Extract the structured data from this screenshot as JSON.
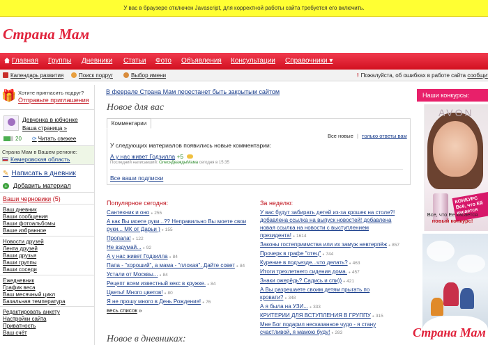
{
  "notice": "У вас в браузере отключен Javascript, для корректной работы сайта требуется его включить.",
  "logo": "Страна Мам",
  "nav": {
    "items": [
      "Главная",
      "Группы",
      "Дневники",
      "Статьи",
      "Фото",
      "Объявления",
      "Консультации",
      "Справочники ▾"
    ]
  },
  "toolbar": {
    "calendar": "Календарь развития",
    "friend_search": "Поиск подруг",
    "name_choice": "Выбор имени",
    "report_prefix": "Пожалуйста, об ошибках в работе сайта",
    "report_link": "сообщите"
  },
  "sidebar": {
    "invite_question": "Хотите пригласить подруг?",
    "invite_link": "Отправьте приглашения",
    "user_name": "Девчонка в юбчонке",
    "user_page": "Ваша страница »",
    "rating": "20",
    "read_fresh": "Читать свежее",
    "region_label": "Страна Мам в Вашем регионе:",
    "region_value": "Кемеровская область",
    "write_diary": "Написать в дневник",
    "add_material": "Добавить материал",
    "drafts": "Ваши черновики",
    "drafts_count": "(5)",
    "links1": [
      "Ваш дневник",
      "Ваши сообщения",
      "Ваши фотоальбомы",
      "Ваше избранное"
    ],
    "links2": [
      "Новости друзей",
      "Лента друзей",
      "Ваши друзья",
      "Ваши группы",
      "Ваши соседи"
    ],
    "links3": [
      "Ежедневник",
      "График веса",
      "Ваш месячный цикл",
      "Базальная температура"
    ],
    "links4": [
      "Редактировать анкету",
      "Настройки сайта",
      "Приватность",
      "Ваш счёт"
    ]
  },
  "center": {
    "announcement": "В феврале Страна Мам перестанет быть закрытым сайтом",
    "new_for_you": "Новое для вас",
    "tab": "Комментарии",
    "filter_all": "Все новые",
    "filter_yours": "только ответы вам",
    "comments_intro": "У следующих материалов появились новые комментарии:",
    "comment_title": "А у нас живет Годзилла",
    "comment_plus": "+5",
    "comment_meta_prefix": "Последний написавший:",
    "comment_author": "ОлесяДваждыМама",
    "comment_time": "сегодня в 15:35",
    "all_subs": "Все ваши подписки",
    "popular_today_title": "Популярное сегодня:",
    "popular_today": [
      {
        "text": "Сантехник и оно",
        "count": "255"
      },
      {
        "text": "А как Вы моете руки...?? Неправильно Вы моете свои",
        "count": ""
      },
      {
        "text": "руки... МК от Дарьи )",
        "count": "155"
      },
      {
        "text": "Пропала!",
        "count": "122"
      },
      {
        "text": "Не вздумай...",
        "count": "92"
      },
      {
        "text": "А у нас живет Годзилла",
        "count": "84"
      },
      {
        "text": "Папа - \"хороший\", а мама - \"плохая\". Дайте совет",
        "count": "84"
      },
      {
        "text": "Устали от Москвы...",
        "count": "84"
      },
      {
        "text": "Рецепт всем известный кекс в кружке.",
        "count": "84"
      },
      {
        "text": "Цветы! Много цветов!",
        "count": "80"
      },
      {
        "text": "Я не прошу много в День Рождения!",
        "count": "76"
      }
    ],
    "full_list": "весь список",
    "week_title": "За неделю:",
    "week": [
      {
        "text": "У вас будут забирать детей из-за крошек на столе?!",
        "count": ""
      },
      {
        "text": "добавлена ссылка на выпуск новостей! добавлена",
        "count": ""
      },
      {
        "text": "новая ссылка на новости с выступлением",
        "count": ""
      },
      {
        "text": "президента!",
        "count": "1614"
      },
      {
        "text": "Законы гостеприимства или их замуж невтерпёж",
        "count": "857"
      },
      {
        "text": "Прочерк в графе \"отец\"",
        "count": "744"
      },
      {
        "text": "Курение в подъезде...что делать?",
        "count": "463"
      },
      {
        "text": "Итоги трехлетнего сидения дома.",
        "count": "457"
      },
      {
        "text": "Знаки ожерёдь? Садись и спи))",
        "count": "421"
      },
      {
        "text": "А Вы разрешаете своим детям прыгать по",
        "count": ""
      },
      {
        "text": "кровати?",
        "count": "348"
      },
      {
        "text": "А я была на УЗИ...",
        "count": "333"
      },
      {
        "text": "КРИТЕРИИ ДЛЯ ВСТУПЛЕНИЯ В ГРУППУ",
        "count": "315"
      },
      {
        "text": "Мне Бог подарил нескaзанное чудо - я стану",
        "count": ""
      },
      {
        "text": "счастливой, я мамою буду!",
        "count": "283"
      }
    ],
    "new_in_diaries": "Новое в дневниках:"
  },
  "right": {
    "contests": "Наши конкурсы:",
    "ad_brand": "AVON",
    "ad_badge_1": "КОНКУРС",
    "ad_badge_2": "Всё, что Ей касается",
    "ad_caption_1": "Все, что Ее касается",
    "ad_caption_2": "новый конкурс!"
  },
  "watermark": "Страна Мам",
  "colors": {
    "brand_red": "#e0213a",
    "link_blue": "#1a3e8c",
    "notice_yellow": "#ffff33",
    "contest_pink": "#e8206a"
  }
}
